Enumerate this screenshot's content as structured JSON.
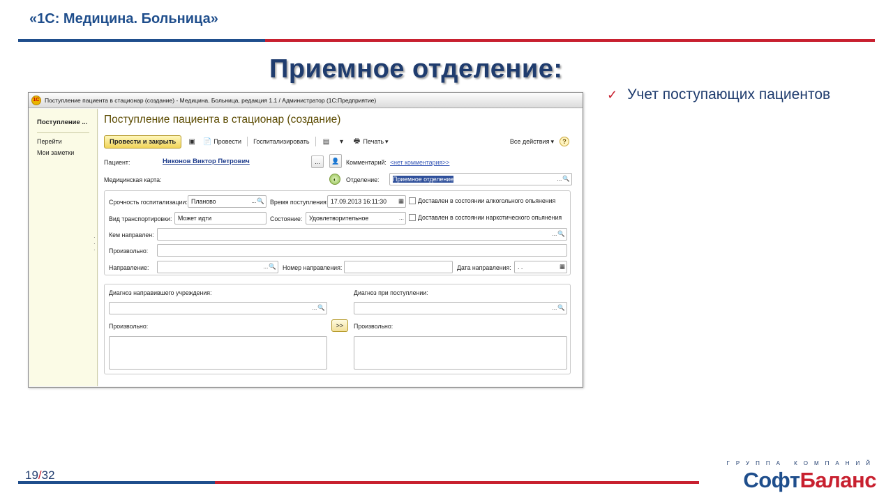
{
  "slide": {
    "header": "«1С: Медицина. Больница»",
    "title": "Приемное отделение:",
    "bullet": "Учет поступающих пациентов",
    "page_current": "19",
    "page_sep": "/",
    "page_total": "32",
    "brand_sub": "ГРУППА КОМПАНИЙ",
    "brand_part1": "Софт",
    "brand_part2": "Баланс",
    "colors": {
      "blue": "#1f4e8c",
      "red": "#c8202f",
      "title": "#1f3c6e"
    }
  },
  "window": {
    "title": "Поступление пациента в стационар (создание) - Медицина. Больница, редакция 1.1 / Администратор  (1С:Предприятие)",
    "logo": "1С",
    "nav": {
      "title": "Поступление ...",
      "items": [
        "Перейти",
        "Мои заметки"
      ]
    },
    "form_title": "Поступление пациента в стационар (создание)",
    "toolbar": {
      "primary": "Провести и закрыть",
      "post": "Провести",
      "hospitalize": "Госпитализировать",
      "print": "Печать",
      "all_actions": "Все действия",
      "help": "?"
    },
    "fields": {
      "patient_label": "Пациент:",
      "patient_value": "Никонов Виктор Петрович",
      "comment_label": "Комментарий:",
      "comment_value": "<нет комментария>>",
      "medcard_label": "Медицинская карта:",
      "department_label": "Отделение:",
      "department_value": "Приемное отделение",
      "urgency_label": "Срочность госпитализации:",
      "urgency_value": "Планово",
      "arrival_time_label": "Время поступления:",
      "arrival_time_value": "17.09.2013 16:11:30",
      "alcohol_label": "Доставлен в состоянии алкогольного опьянения",
      "transport_label": "Вид транспортировки:",
      "transport_value": "Может идти",
      "state_label": "Состояние:",
      "state_value": "Удовлетворительное",
      "narcotic_label": "Доставлен в состоянии наркотического опьянения",
      "referred_by_label": "Кем направлен:",
      "arbitrary_label": "Произвольно:",
      "referral_label": "Направление:",
      "referral_number_label": "Номер направления:",
      "referral_date_label": "Дата направления:",
      "referral_date_value": " .  .",
      "diag_ref_label": "Диагноз направившего учреждения:",
      "diag_arrival_label": "Диагноз при поступлении:",
      "free1_label": "Произвольно:",
      "free2_label": "Произвольно:",
      "copy_button": ">>"
    }
  }
}
